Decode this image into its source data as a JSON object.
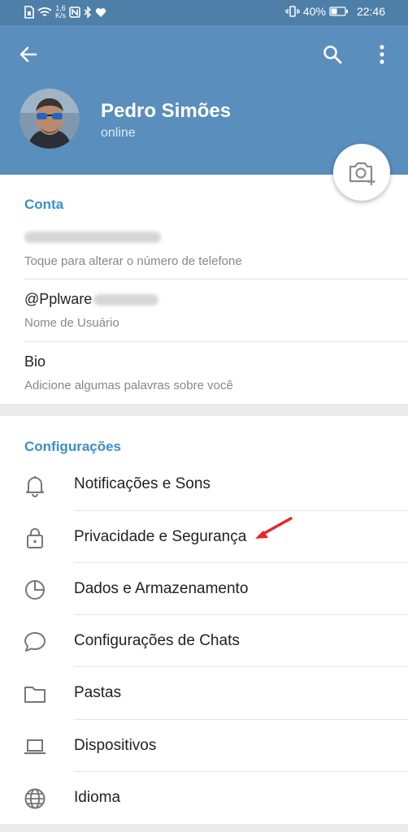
{
  "status_bar": {
    "speed_top": "1,6",
    "speed_bottom": "K/s",
    "battery": "40%",
    "time": "22:46",
    "icons": [
      "sim-icon",
      "wifi-icon",
      "nfc-icon",
      "bluetooth-icon",
      "heart-icon",
      "vibrate-icon",
      "battery-icon"
    ]
  },
  "header": {
    "name": "Pedro Simões",
    "status": "online",
    "icons": [
      "back-arrow-icon",
      "search-icon",
      "more-vert-icon",
      "camera-add-icon"
    ]
  },
  "account": {
    "title": "Conta",
    "phone_hint": "Toque para alterar o número de telefone",
    "username_visible": "@Pplware",
    "username_hint": "Nome de Usuário",
    "bio_label": "Bio",
    "bio_hint": "Adicione algumas palavras sobre você"
  },
  "settings": {
    "title": "Configurações",
    "items": [
      {
        "label": "Notificações e Sons",
        "icon": "bell-icon"
      },
      {
        "label": "Privacidade e Segurança",
        "icon": "lock-icon"
      },
      {
        "label": "Dados e Armazenamento",
        "icon": "pie-chart-icon"
      },
      {
        "label": "Configurações de Chats",
        "icon": "chat-bubble-icon"
      },
      {
        "label": "Pastas",
        "icon": "folder-icon"
      },
      {
        "label": "Dispositivos",
        "icon": "laptop-icon"
      },
      {
        "label": "Idioma",
        "icon": "globe-icon"
      }
    ]
  },
  "colors": {
    "header": "#5a8ebc",
    "status_bar": "#4e7fa8",
    "accent": "#3a8fc6",
    "annotation_arrow": "#e8262a"
  }
}
